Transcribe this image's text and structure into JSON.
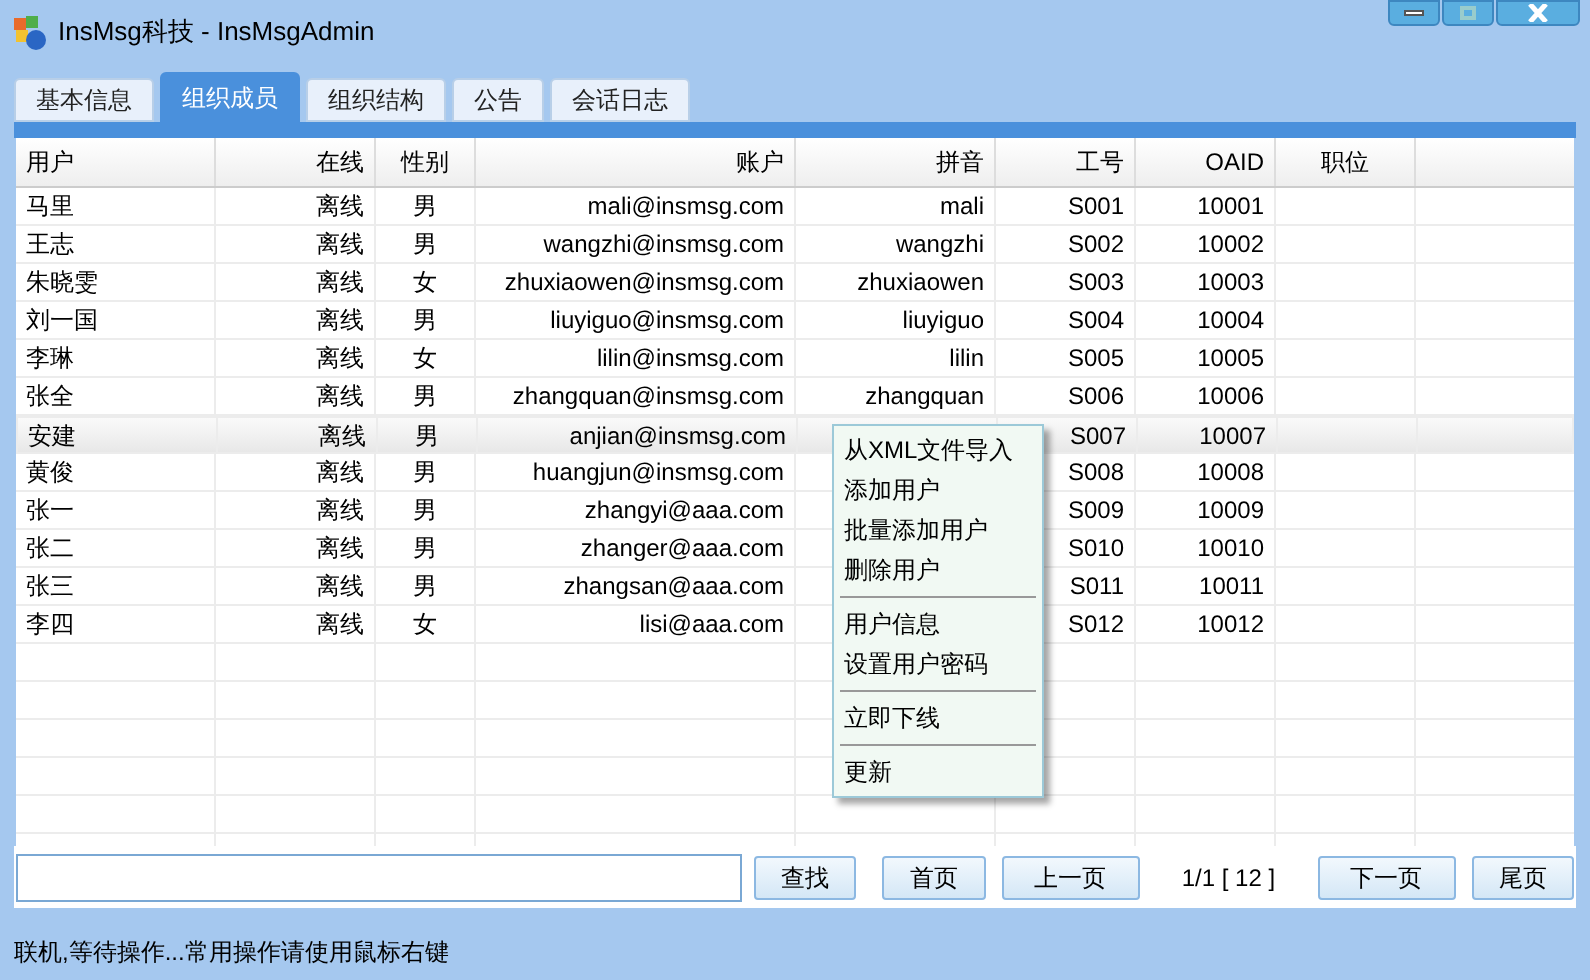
{
  "window": {
    "title": "InsMsg科技 - InsMsgAdmin"
  },
  "tabs": [
    {
      "label": "基本信息",
      "selected": false
    },
    {
      "label": "组织成员",
      "selected": true
    },
    {
      "label": "组织结构",
      "selected": false
    },
    {
      "label": "公告",
      "selected": false
    },
    {
      "label": "会话日志",
      "selected": false
    }
  ],
  "table": {
    "columns": [
      {
        "label": "用户"
      },
      {
        "label": "在线"
      },
      {
        "label": "性别"
      },
      {
        "label": "账户"
      },
      {
        "label": "拼音"
      },
      {
        "label": "工号"
      },
      {
        "label": "OAID"
      },
      {
        "label": "职位"
      }
    ],
    "rows": [
      {
        "selected": false,
        "cells": [
          "马里",
          "离线",
          "男",
          "mali@insmsg.com",
          "mali",
          "S001",
          "10001"
        ]
      },
      {
        "selected": false,
        "cells": [
          "王志",
          "离线",
          "男",
          "wangzhi@insmsg.com",
          "wangzhi",
          "S002",
          "10002"
        ]
      },
      {
        "selected": false,
        "cells": [
          "朱晓雯",
          "离线",
          "女",
          "zhuxiaowen@insmsg.com",
          "zhuxiaowen",
          "S003",
          "10003"
        ]
      },
      {
        "selected": false,
        "cells": [
          "刘一国",
          "离线",
          "男",
          "liuyiguo@insmsg.com",
          "liuyiguo",
          "S004",
          "10004"
        ]
      },
      {
        "selected": false,
        "cells": [
          "李琳",
          "离线",
          "女",
          "lilin@insmsg.com",
          "lilin",
          "S005",
          "10005"
        ]
      },
      {
        "selected": false,
        "cells": [
          "张全",
          "离线",
          "男",
          "zhangquan@insmsg.com",
          "zhangquan",
          "S006",
          "10006"
        ]
      },
      {
        "selected": true,
        "cells": [
          "安建",
          "离线",
          "男",
          "anjian@insmsg.com",
          null,
          "S007",
          "10007"
        ]
      },
      {
        "selected": false,
        "cells": [
          "黄俊",
          "离线",
          "男",
          "huangjun@insmsg.com",
          null,
          "S008",
          "10008"
        ]
      },
      {
        "selected": false,
        "cells": [
          "张一",
          "离线",
          "男",
          "zhangyi@aaa.com",
          null,
          "S009",
          "10009"
        ]
      },
      {
        "selected": false,
        "cells": [
          "张二",
          "离线",
          "男",
          "zhanger@aaa.com",
          null,
          "S010",
          "10010"
        ]
      },
      {
        "selected": false,
        "cells": [
          "张三",
          "离线",
          "男",
          "zhangsan@aaa.com",
          null,
          "S011",
          "10011"
        ]
      },
      {
        "selected": false,
        "cells": [
          "李四",
          "离线",
          "女",
          "lisi@aaa.com",
          null,
          "S012",
          "10012"
        ]
      }
    ]
  },
  "context_menu": [
    {
      "kind": "item",
      "label": "从XML文件导入"
    },
    {
      "kind": "item",
      "label": "添加用户"
    },
    {
      "kind": "item",
      "label": "批量添加用户"
    },
    {
      "kind": "item",
      "label": "删除用户"
    },
    {
      "kind": "separator"
    },
    {
      "kind": "item",
      "label": "用户信息"
    },
    {
      "kind": "item",
      "label": "设置用户密码"
    },
    {
      "kind": "separator"
    },
    {
      "kind": "item",
      "label": "立即下线"
    },
    {
      "kind": "separator"
    },
    {
      "kind": "item",
      "label": "更新"
    }
  ],
  "toolbar": {
    "search_button": "查找",
    "first_button": "首页",
    "prev_button": "上一页",
    "page_info": "1/1 [ 12 ]",
    "next_button": "下一页",
    "last_button": "尾页"
  },
  "status_bar": "联机,等待操作...常用操作请使用鼠标右键"
}
